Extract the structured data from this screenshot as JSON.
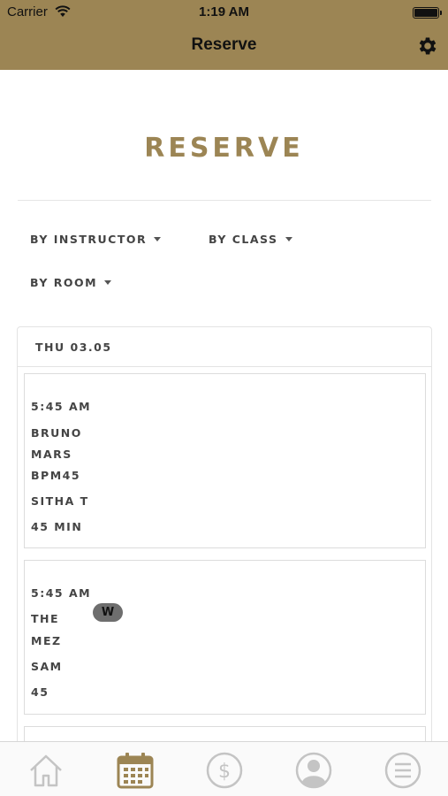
{
  "status_bar": {
    "carrier": "Carrier",
    "time": "1:19 AM"
  },
  "nav": {
    "title": "Reserve",
    "settings_icon": "gear-icon"
  },
  "heading": "RESERVE",
  "filters": {
    "instructor": "BY INSTRUCTOR",
    "class": "BY CLASS",
    "room": "BY ROOM"
  },
  "schedule": {
    "day": "THU 03.05",
    "classes": [
      {
        "time": "5:45 AM",
        "name_line1": "BRUNO",
        "name_line2": "MARS",
        "name_line3": "BPM45",
        "instructor": "SITHA T",
        "duration": "45 MIN"
      },
      {
        "time": "5:45 AM",
        "name_line1": "THE",
        "name_line2": "MEZ",
        "badge": "W",
        "instructor": "SAM",
        "duration": "45"
      }
    ]
  },
  "tabbar": {
    "items": [
      "home-icon",
      "calendar-icon",
      "dollar-icon",
      "profile-icon",
      "menu-icon"
    ],
    "active": "calendar-icon"
  },
  "colors": {
    "brand": "#9c8554",
    "tab_inactive": "#c4c4c4",
    "text": "#444444"
  }
}
